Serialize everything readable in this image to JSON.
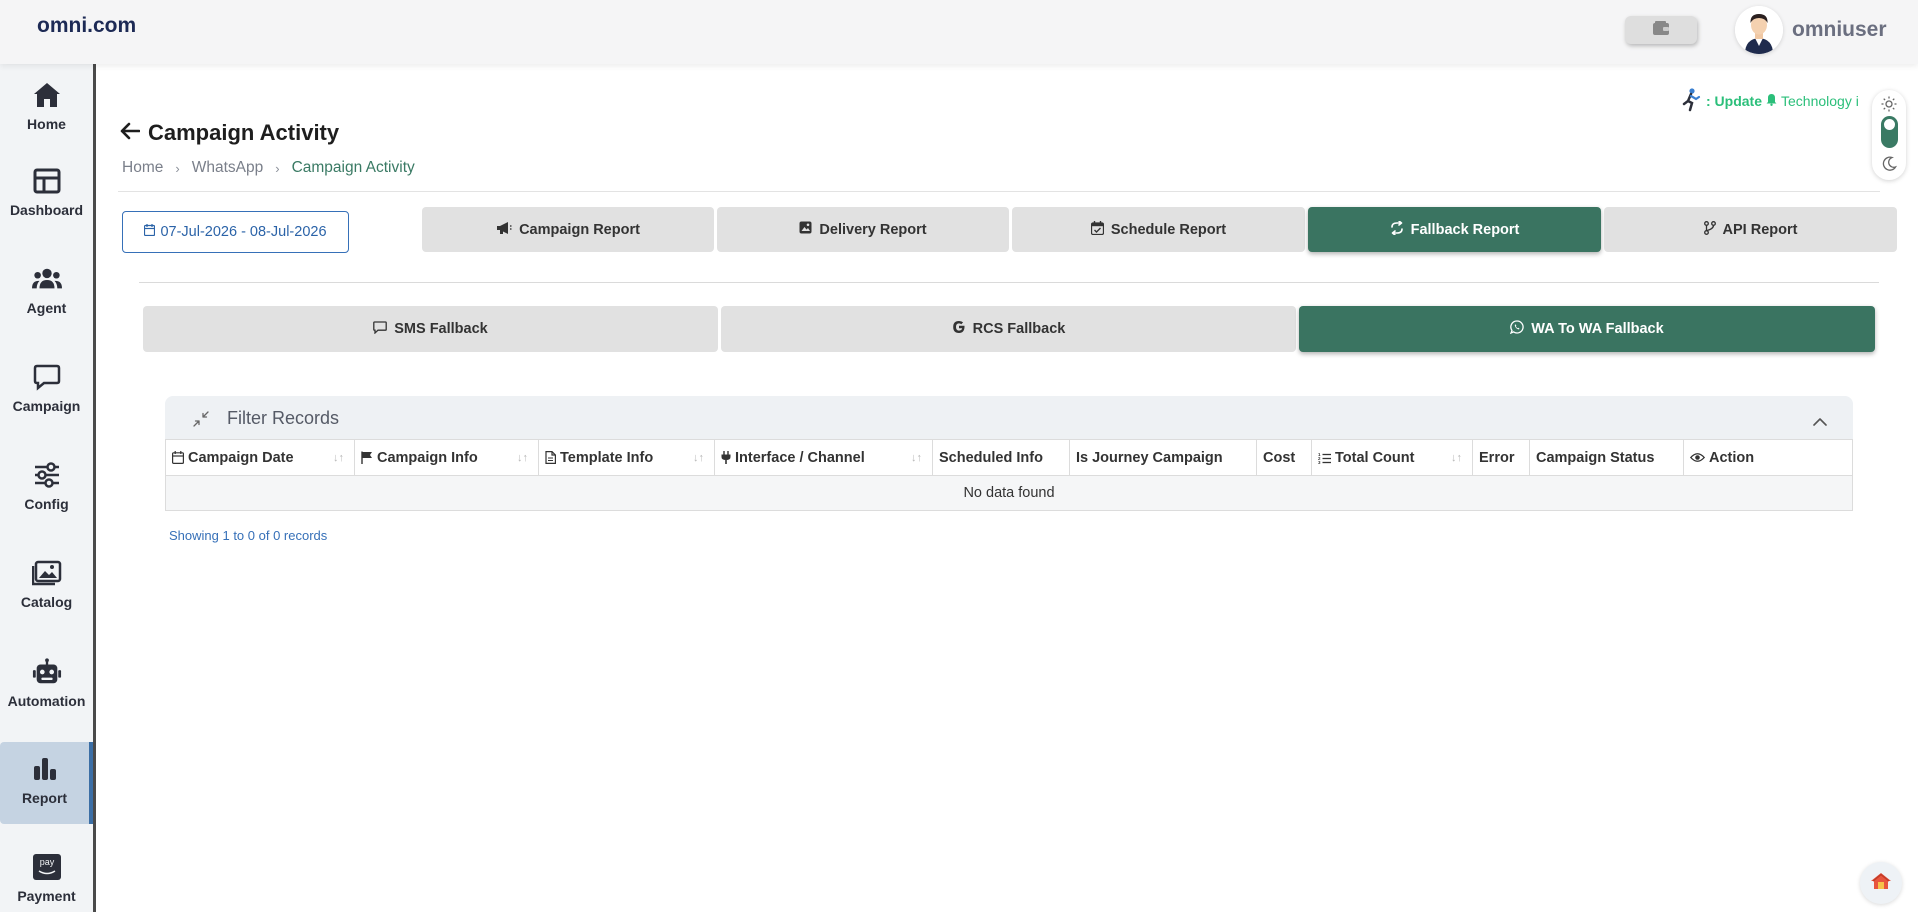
{
  "header": {
    "logo": "omni.com",
    "username": "omniuser"
  },
  "sidebar": {
    "items": [
      {
        "label": "Home",
        "icon": "home-icon"
      },
      {
        "label": "Dashboard",
        "icon": "dashboard-icon"
      },
      {
        "label": "Agent",
        "icon": "agent-icon"
      },
      {
        "label": "Campaign",
        "icon": "campaign-icon"
      },
      {
        "label": "Config",
        "icon": "config-icon"
      },
      {
        "label": "Catalog",
        "icon": "catalog-icon"
      },
      {
        "label": "Automation",
        "icon": "robot-icon"
      },
      {
        "label": "Report",
        "icon": "report-icon",
        "active": true
      },
      {
        "label": "Payment",
        "icon": "payment-icon"
      }
    ]
  },
  "ticker": {
    "update": ": Update",
    "text": "Technology i"
  },
  "page": {
    "title": "Campaign Activity",
    "breadcrumb": [
      "Home",
      "WhatsApp",
      "Campaign Activity"
    ],
    "date_range": "07-Jul-2026 - 08-Jul-2026"
  },
  "report_tabs": [
    {
      "label": "Campaign Report",
      "icon": "megaphone-icon",
      "active": false
    },
    {
      "label": "Delivery Report",
      "icon": "image-report-icon",
      "active": false
    },
    {
      "label": "Schedule Report",
      "icon": "calendar-check-icon",
      "active": false
    },
    {
      "label": "Fallback Report",
      "icon": "refresh-icon",
      "active": true
    },
    {
      "label": "API Report",
      "icon": "branch-icon",
      "active": false
    }
  ],
  "fallback_tabs": [
    {
      "label": "SMS Fallback",
      "icon": "message-icon",
      "active": false
    },
    {
      "label": "RCS Fallback",
      "icon": "google-icon",
      "active": false
    },
    {
      "label": "WA To WA Fallback",
      "icon": "whatsapp-icon",
      "active": true
    }
  ],
  "filter": {
    "title": "Filter Records"
  },
  "table": {
    "columns": [
      {
        "label": "Campaign Date",
        "icon": "calendar-icon",
        "sortable": true
      },
      {
        "label": "Campaign Info",
        "icon": "flag-icon",
        "sortable": true
      },
      {
        "label": "Template Info",
        "icon": "file-icon",
        "sortable": true
      },
      {
        "label": "Interface / Channel",
        "icon": "plug-icon",
        "sortable": true
      },
      {
        "label": "Scheduled Info",
        "icon": "",
        "sortable": false
      },
      {
        "label": "Is Journey Campaign",
        "icon": "",
        "sortable": false
      },
      {
        "label": "Cost",
        "icon": "",
        "sortable": false
      },
      {
        "label": "Total Count",
        "icon": "list-icon",
        "sortable": true
      },
      {
        "label": "Error",
        "icon": "",
        "sortable": false
      },
      {
        "label": "Campaign Status",
        "icon": "",
        "sortable": false
      },
      {
        "label": "Action",
        "icon": "eye-icon",
        "sortable": false
      }
    ],
    "empty_message": "No data found",
    "records_info": "Showing 1 to 0 of 0 records"
  },
  "colors": {
    "accent_green": "#3a7461",
    "link_blue": "#3670b8",
    "sidebar_active": "#c5d3e2"
  }
}
